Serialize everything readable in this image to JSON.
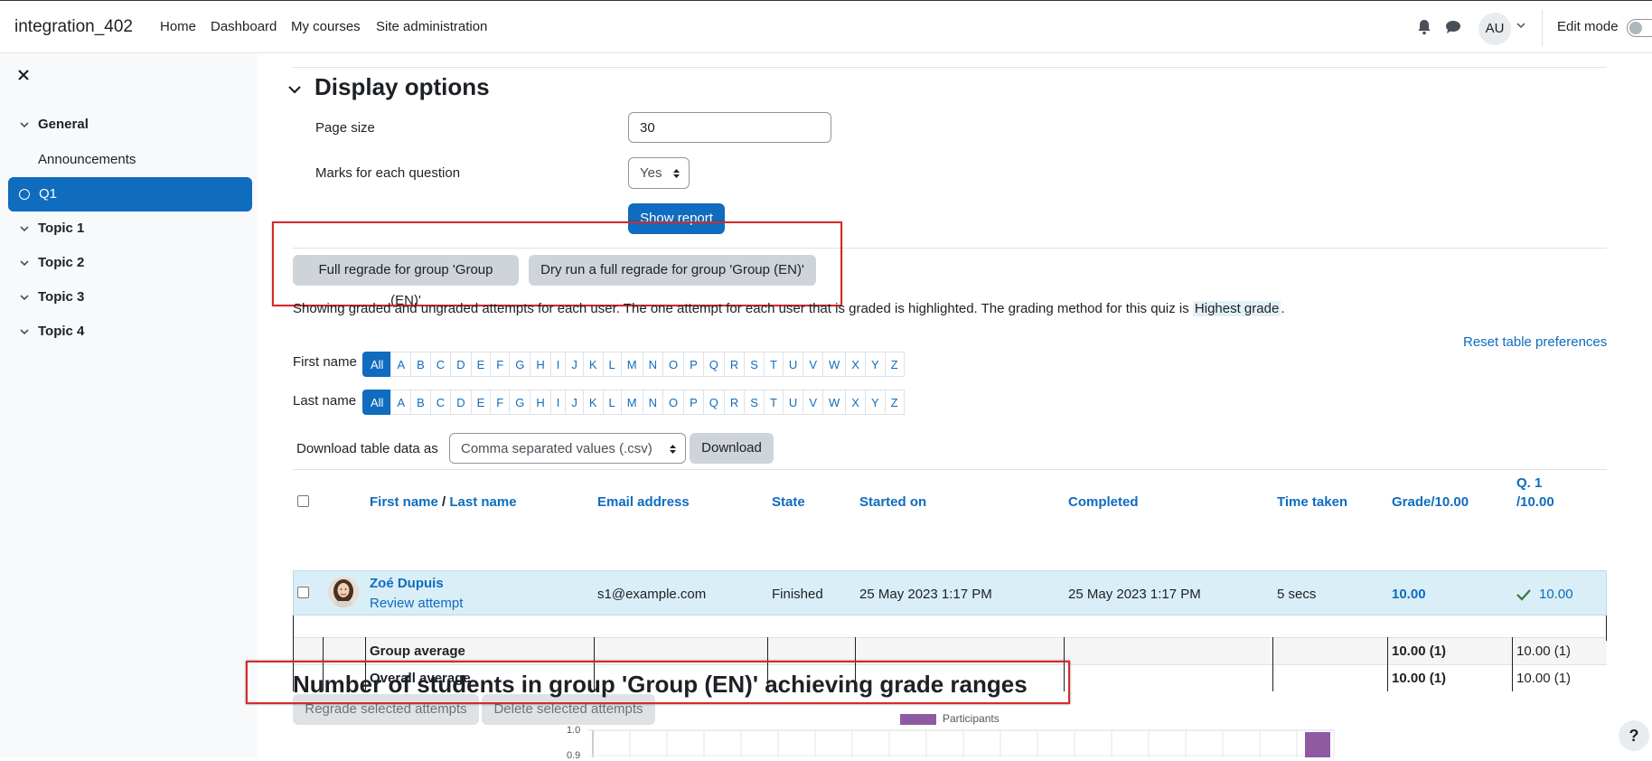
{
  "navbar": {
    "brand": "integration_402",
    "links": [
      "Home",
      "Dashboard",
      "My courses",
      "Site administration"
    ],
    "user_initials": "AU",
    "edit_mode_label": "Edit mode"
  },
  "sidebar": {
    "sections": [
      {
        "label": "General"
      },
      {
        "label": "Topic 1"
      },
      {
        "label": "Topic 2"
      },
      {
        "label": "Topic 3"
      },
      {
        "label": "Topic 4"
      }
    ],
    "items": [
      {
        "label": "Announcements"
      },
      {
        "label": "Q1"
      }
    ]
  },
  "display_options": {
    "title": "Display options",
    "page_size_label": "Page size",
    "page_size_value": "30",
    "marks_label": "Marks for each question",
    "marks_value": "Yes",
    "show_report": "Show report"
  },
  "regrade": {
    "full": "Full regrade for group 'Group (EN)'",
    "dry_run": "Dry run a full regrade for group 'Group (EN)'"
  },
  "info": {
    "text": "Showing graded and ungraded attempts for each user. The one attempt for each user that is graded is highlighted. The grading method for this quiz is ",
    "method": "Highest grade",
    "end": "."
  },
  "reset_prefs": "Reset table preferences",
  "initials": {
    "first_label": "First name",
    "last_label": "Last name",
    "letters": [
      "All",
      "A",
      "B",
      "C",
      "D",
      "E",
      "F",
      "G",
      "H",
      "I",
      "J",
      "K",
      "L",
      "M",
      "N",
      "O",
      "P",
      "Q",
      "R",
      "S",
      "T",
      "U",
      "V",
      "W",
      "X",
      "Y",
      "Z"
    ]
  },
  "download": {
    "label": "Download table data as",
    "format": "Comma separated values (.csv)",
    "button": "Download"
  },
  "table": {
    "headers": {
      "first_name": "First name",
      "sep": " / ",
      "last_name": "Last name",
      "email": "Email address",
      "state": "State",
      "started": "Started on",
      "completed": "Completed",
      "time_taken": "Time taken",
      "grade": "Grade/10.00",
      "q1_a": "Q. 1",
      "q1_b": "/10.00"
    },
    "row": {
      "name": "Zoé Dupuis",
      "review": "Review attempt",
      "email": "s1@example.com",
      "state": "Finished",
      "started": "25 May 2023 1:17 PM",
      "completed": "25 May 2023 1:17 PM",
      "time_taken": "5 secs",
      "grade": "10.00",
      "q1": "10.00"
    },
    "group_avg": {
      "label": "Group average",
      "grade": "10.00 (1)",
      "q1": "10.00 (1)"
    },
    "overall_avg": {
      "label": "Overall average",
      "grade": "10.00 (1)",
      "q1": "10.00 (1)"
    }
  },
  "bulk": {
    "regrade": "Regrade selected attempts",
    "delete": "Delete selected attempts"
  },
  "chart": {
    "title": "Number of students in group 'Group (EN)' achieving grade ranges",
    "legend": "Participants",
    "y_top_label": "1.0",
    "y_second_label": "0.9",
    "color": "#8e5ba3"
  },
  "help": "?"
}
